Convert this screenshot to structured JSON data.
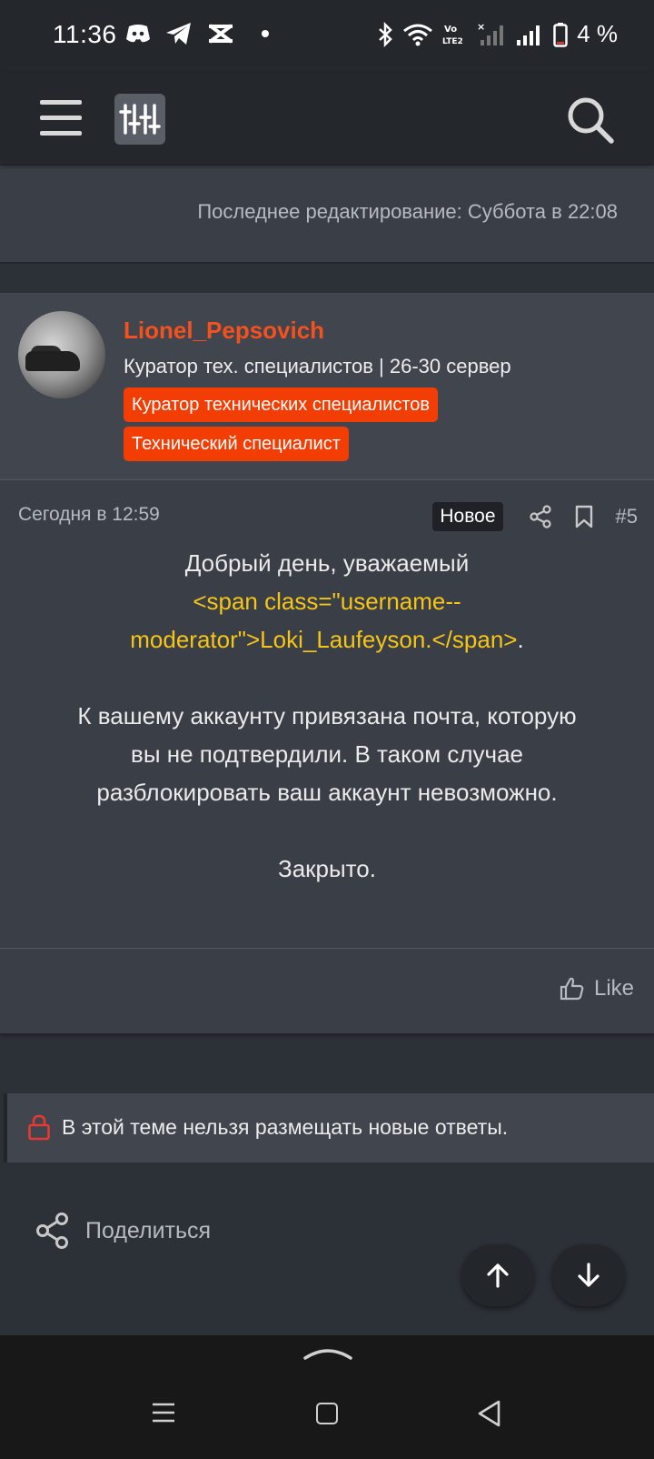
{
  "status_bar": {
    "time": "11:36",
    "volte": "Vo LTE2",
    "battery": "4 %"
  },
  "previous_post": {
    "last_edited": "Последнее редактирование: Суббота в 22:08"
  },
  "post": {
    "author": "Lionel_Pepsovich",
    "author_title": "Куратор тех. специалистов | 26-30 сервер",
    "badges": [
      "Куратор технических специалистов",
      "Технический специалист"
    ],
    "date": "Сегодня в 12:59",
    "new_label": "Новое",
    "number": "#5",
    "body": {
      "line1": "Добрый день, уважаемый",
      "line2_highlight": "<span class=\"username--",
      "line3_highlight": "moderator\">Loki_Laufeyson.</span>",
      "line3_suffix": ".",
      "para2_line1": "К вашему аккаунту привязана почта, которую",
      "para2_line2": "вы не подтвердили. В таком случае",
      "para2_line3": "разблокировать ваш аккаунт невозможно.",
      "para3": "Закрыто."
    },
    "like_label": "Like"
  },
  "locked_notice": "В этой теме нельзя размещать новые ответы.",
  "share_label": "Поделиться",
  "colors": {
    "accent": "#f4511e",
    "badge": "#f23d05",
    "highlight": "#f5c518",
    "lock": "#e53935"
  }
}
